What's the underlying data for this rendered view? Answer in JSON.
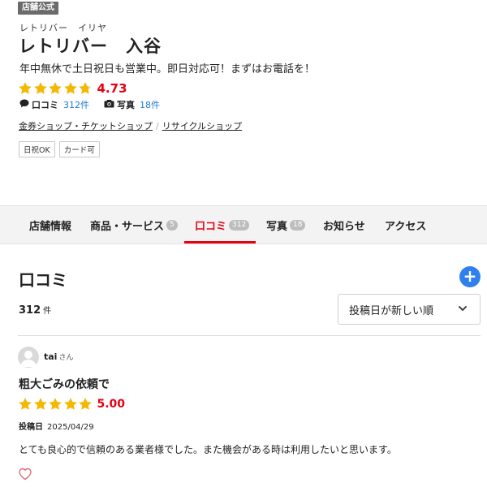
{
  "store": {
    "badge": "店舗公式",
    "reading": "レトリバー　イリヤ",
    "name": "レトリバー　入谷",
    "catch": "年中無休で土日祝日も営業中。即日対応可！まずはお電話を！",
    "rating": "4.73",
    "rating_value": 4.73,
    "reviews_label": "口コミ",
    "reviews_count": "312件",
    "photos_label": "写真",
    "photos_count": "18件",
    "categories": [
      "金券ショップ・チケットショップ",
      "リサイクルショップ"
    ],
    "category_separator": "/",
    "tags": [
      "日祝OK",
      "カード可"
    ]
  },
  "tabs": [
    {
      "label": "店舗情報",
      "count": ""
    },
    {
      "label": "商品・サービス",
      "count": "5"
    },
    {
      "label": "口コミ",
      "count": "312",
      "active": true
    },
    {
      "label": "写真",
      "count": "18"
    },
    {
      "label": "お知らせ",
      "count": ""
    },
    {
      "label": "アクセス",
      "count": ""
    }
  ],
  "reviews_section": {
    "title": "口コミ",
    "add_symbol": "+",
    "count": "312",
    "count_unit": "件",
    "sort_selected": "投稿日が新しい順"
  },
  "review": {
    "user": "tai",
    "honorific": "さん",
    "title": "粗大ごみの依頼で",
    "rating": "5.00",
    "rating_value": 5.0,
    "posted_label": "投稿日",
    "posted_date": "2025/04/29",
    "body": "とても良心的で信頼のある業者様でした。また機会がある時は利用したいと思います。"
  },
  "colors": {
    "accent_red": "#e60012",
    "star_yellow": "#f5b800",
    "link_blue": "#1f7ad6",
    "add_blue": "#2f80ed"
  },
  "icons": {
    "chat": "chat-bubble-icon",
    "camera": "camera-icon",
    "plus": "plus-icon",
    "chevron": "chevron-down-icon",
    "heart": "heart-outline-icon",
    "avatar": "user-avatar-icon"
  }
}
